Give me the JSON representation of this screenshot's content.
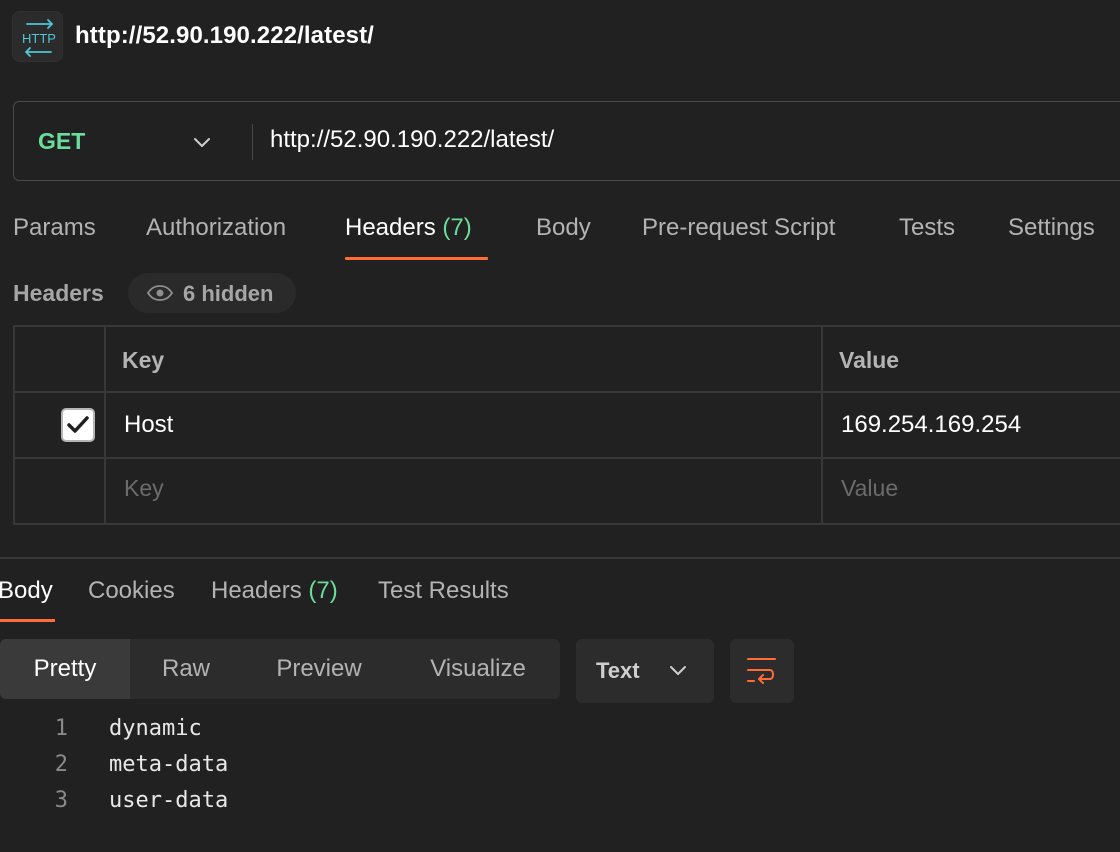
{
  "window": {
    "badge_text": "HTTP",
    "title": "http://52.90.190.222/latest/"
  },
  "request": {
    "method": "GET",
    "url": "http://52.90.190.222/latest/"
  },
  "request_tabs": [
    {
      "label": "Params"
    },
    {
      "label": "Authorization"
    },
    {
      "label": "Headers",
      "count": "(7)"
    },
    {
      "label": "Body"
    },
    {
      "label": "Pre-request Script"
    },
    {
      "label": "Tests"
    },
    {
      "label": "Settings"
    }
  ],
  "headers_section": {
    "label": "Headers",
    "hidden_label": "6 hidden",
    "columns": {
      "key": "Key",
      "value": "Value"
    },
    "rows": [
      {
        "checked": true,
        "key": "Host",
        "value": "169.254.169.254"
      }
    ],
    "placeholder": {
      "key": "Key",
      "value": "Value"
    }
  },
  "response_tabs": [
    {
      "label": "Body"
    },
    {
      "label": "Cookies"
    },
    {
      "label": "Headers",
      "count": "(7)"
    },
    {
      "label": "Test Results"
    }
  ],
  "body_toolbar": {
    "views": [
      "Pretty",
      "Raw",
      "Preview",
      "Visualize"
    ],
    "format": "Text"
  },
  "response_body": [
    {
      "line": "1",
      "text": "dynamic"
    },
    {
      "line": "2",
      "text": "meta-data"
    },
    {
      "line": "3",
      "text": "user-data"
    }
  ],
  "colors": {
    "accent": "#ff6c37",
    "method_get": "#6bdd9a",
    "background": "#212121"
  }
}
